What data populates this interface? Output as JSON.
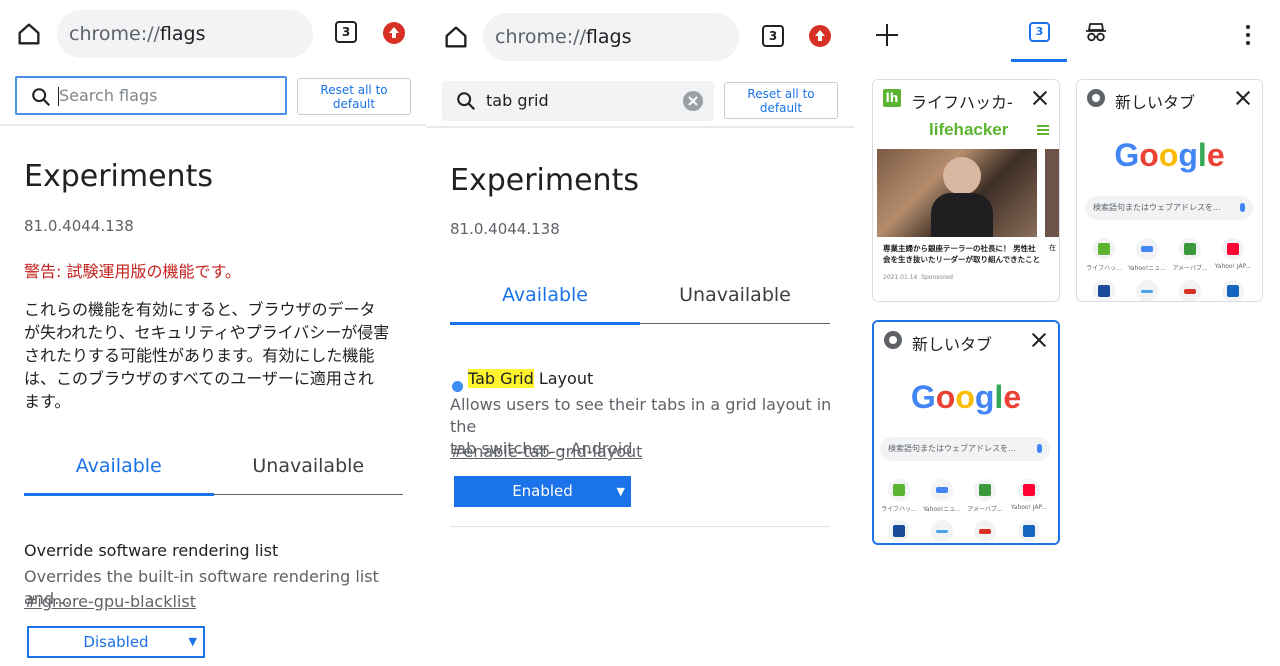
{
  "panel1": {
    "omnibox": {
      "scheme": "chrome://",
      "host": "flags"
    },
    "tab_count": "3",
    "search_placeholder": "Search flags",
    "reset_label_1": "Reset all to",
    "reset_label_2": "default",
    "title": "Experiments",
    "version": "81.0.4044.138",
    "warning": "警告: 試験運用版の機能です。",
    "description_lines": [
      "これらの機能を有効にすると、ブラウザのデータ",
      "が失われたり、セキュリティやプライバシーが侵害",
      "されたりする可能性があります。有効にした機能",
      "は、このブラウザのすべてのユーザーに適用され",
      "ます。"
    ],
    "tabs": {
      "available": "Available",
      "unavailable": "Unavailable"
    },
    "flag": {
      "title": "Override software rendering list",
      "description": "Overrides the built-in software rendering list and…",
      "link": "#ignore-gpu-blacklist",
      "select_value": "Disabled"
    }
  },
  "panel2": {
    "omnibox": {
      "scheme": "chrome://",
      "host": "flags"
    },
    "tab_count": "3",
    "search_value": "tab grid",
    "reset_label_1": "Reset all to",
    "reset_label_2": "default",
    "title": "Experiments",
    "version": "81.0.4044.138",
    "tabs": {
      "available": "Available",
      "unavailable": "Unavailable"
    },
    "flag": {
      "title_highlight": "Tab Grid",
      "title_rest": " Layout",
      "description_line1": "Allows users to see their tabs in a grid layout in the",
      "description_line2": "tab switcher. – Android",
      "link": "#enable-tab-grid-layout",
      "select_value": "Enabled"
    }
  },
  "panel3": {
    "tab_count": "3",
    "cards": [
      {
        "title": "ライフハッカ-",
        "favicon_text": "lh",
        "logo": "lifehacker",
        "article_text": "専業主婦から銀座テーラーの社長に！ 男性社会を生き抜いたリーダーが取り組んできたこと",
        "meta_date": "2021.01.14",
        "meta_sponsored": "Sponsored",
        "side_text": "在"
      },
      {
        "title": "新しいタブ",
        "search_placeholder": "検索語句またはウェブアドレスを...",
        "tiles": [
          "ライフハッ...",
          "Yahoo!ニュ...",
          "アメーバブ...",
          "Yahoo! JAP..."
        ]
      },
      {
        "title": "新しいタブ",
        "search_placeholder": "検索語句またはウェブアドレスを...",
        "tiles": [
          "ライフハッ...",
          "Yahoo!ニュ...",
          "アメーバブ...",
          "Yahoo! JAP..."
        ]
      }
    ]
  },
  "colors": {
    "accent": "#1a73e8",
    "warning": "#c5221f",
    "highlight": "#fff22f",
    "update": "#d93025"
  }
}
